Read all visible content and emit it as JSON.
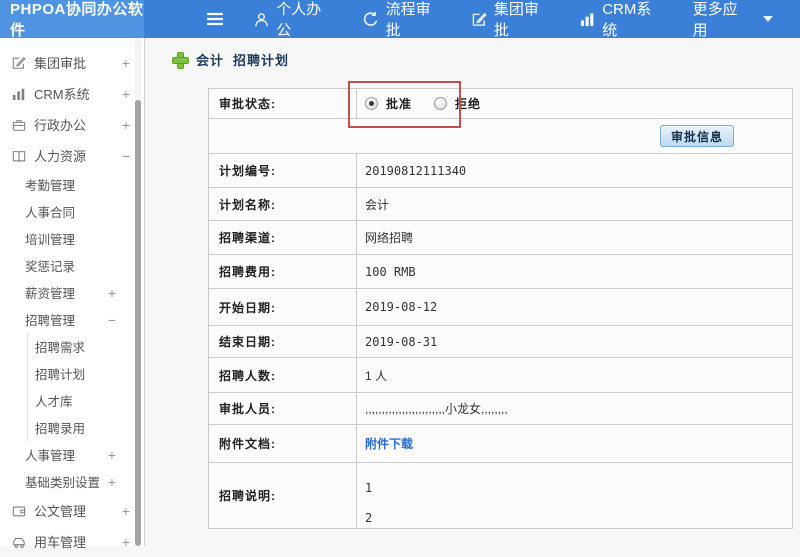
{
  "colors": {
    "topbar_blue": "#3a80d9",
    "logo_blue": "#4f94e2",
    "annotation_red": "#c0504d",
    "link_blue": "#2b6cd4",
    "title_navy": "#1c3a5c",
    "button_blue_border": "#7fadd6"
  },
  "topbar": {
    "logo": "PHPOA协同办公软件",
    "nav": [
      {
        "label": "个人办公",
        "icon": "user-icon"
      },
      {
        "label": "流程审批",
        "icon": "process-cycle-icon"
      },
      {
        "label": "集团审批",
        "icon": "edit-icon"
      },
      {
        "label": "CRM系统",
        "icon": "bar-chart-icon"
      },
      {
        "label": "更多应用",
        "icon": "chevron-down-icon"
      }
    ]
  },
  "sidebar": {
    "items": [
      {
        "label": "集团审批",
        "icon": "edit-icon",
        "expander": "+"
      },
      {
        "label": "CRM系统",
        "icon": "bar-chart-icon",
        "expander": "+"
      },
      {
        "label": "行政办公",
        "icon": "briefcase-icon",
        "expander": "+"
      },
      {
        "label": "人力资源",
        "icon": "book-icon",
        "expander": "−"
      },
      {
        "label": "考勤管理"
      },
      {
        "label": "人事合同"
      },
      {
        "label": "培训管理"
      },
      {
        "label": "奖惩记录"
      },
      {
        "label": "薪资管理",
        "expander": "+"
      },
      {
        "label": "招聘管理",
        "expander": "−"
      },
      {
        "label": "招聘需求"
      },
      {
        "label": "招聘计划"
      },
      {
        "label": "人才库"
      },
      {
        "label": "招聘录用"
      },
      {
        "label": "人事管理",
        "expander": "+"
      },
      {
        "label": "基础类别设置",
        "expander": "+"
      },
      {
        "label": "公文管理",
        "icon": "document-icon",
        "expander": "+"
      },
      {
        "label": "用车管理",
        "icon": "car-icon",
        "expander": "+"
      }
    ]
  },
  "main": {
    "title_plan": "会计",
    "title_page": "招聘计划",
    "approve_info_button": "审批信息",
    "form": {
      "status_label": "审批状态:",
      "radio_approve": "批准",
      "radio_reject": "拒绝",
      "rows": [
        {
          "label": "计划编号:",
          "value": "20190812111340"
        },
        {
          "label": "计划名称:",
          "value": "会计"
        },
        {
          "label": "招聘渠道:",
          "value": "网络招聘"
        },
        {
          "label": "招聘费用:",
          "value": "100 RMB"
        },
        {
          "label": "开始日期:",
          "value": "2019-08-12"
        },
        {
          "label": "结束日期:",
          "value": "2019-08-31"
        },
        {
          "label": "招聘人数:",
          "value": "1 人"
        },
        {
          "label": "审批人员:",
          "value": ",,,,,,,,,,,,,,,,,,,,,,,,小龙女,,,,,,,,"
        },
        {
          "label": "附件文档:",
          "value": "附件下载"
        },
        {
          "label": "招聘说明:",
          "value": "1\n2"
        }
      ]
    }
  }
}
